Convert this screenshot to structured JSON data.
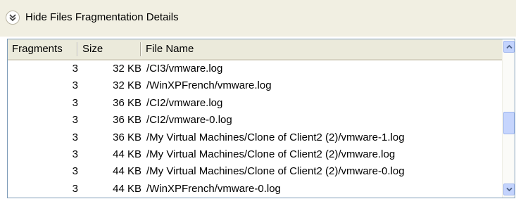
{
  "details_toggle": {
    "icon": "collapse-chevrons-icon",
    "label": "Hide Files Fragmentation Details"
  },
  "file_list": {
    "columns": [
      "Fragments",
      "Size",
      "File Name"
    ],
    "rows": [
      {
        "fragments": "3",
        "size": "32 KB",
        "file_name": "/CI3/vmware.log"
      },
      {
        "fragments": "3",
        "size": "32 KB",
        "file_name": "/WinXPFrench/vmware.log"
      },
      {
        "fragments": "3",
        "size": "36 KB",
        "file_name": "/CI2/vmware.log"
      },
      {
        "fragments": "3",
        "size": "36 KB",
        "file_name": "/CI2/vmware-0.log"
      },
      {
        "fragments": "3",
        "size": "36 KB",
        "file_name": "/My Virtual Machines/Clone of Client2 (2)/vmware-1.log"
      },
      {
        "fragments": "3",
        "size": "44 KB",
        "file_name": "/My Virtual Machines/Clone of Client2 (2)/vmware.log"
      },
      {
        "fragments": "3",
        "size": "44 KB",
        "file_name": "/My Virtual Machines/Clone of Client2 (2)/vmware-0.log"
      },
      {
        "fragments": "3",
        "size": "44 KB",
        "file_name": "/WinXPFrench/vmware-0.log"
      }
    ]
  },
  "scrollbar": {
    "up_icon": "scroll-up-arrow-icon",
    "down_icon": "scroll-down-arrow-icon",
    "position_fraction": 0.55
  }
}
